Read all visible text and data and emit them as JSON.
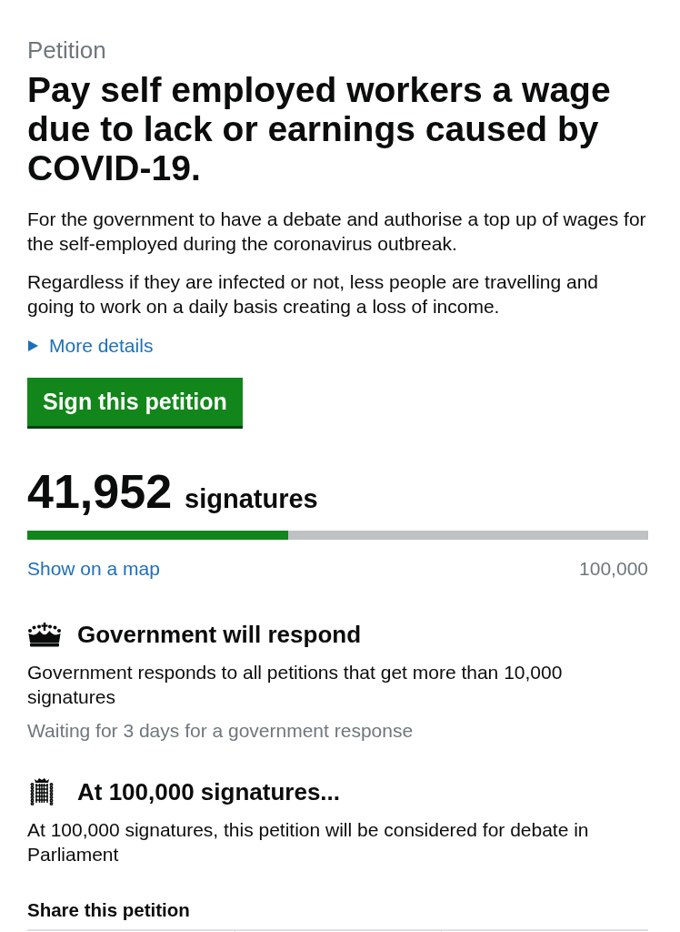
{
  "header": {
    "label": "Petition"
  },
  "title": "Pay self employed workers a wage due to lack or earnings caused by COVID-19.",
  "summary": [
    "For the government to have a debate and authorise a top up of wages for the self-employed during the coronavirus outbreak.",
    "Regardless if they are infected or not, less people are travelling and going to work on a daily basis creating a loss of income."
  ],
  "details_toggle": {
    "label": "More details",
    "expanded": false
  },
  "sign_button": {
    "label": "Sign this petition"
  },
  "signatures": {
    "count": "41,952",
    "label": "signatures",
    "level": 0.41952,
    "map_link": "Show on a map",
    "target": "100,000"
  },
  "thresholds": [
    {
      "kind": "crown",
      "heading": "Government will respond",
      "text": "Government responds to all petitions that get more than 10,000 signatures",
      "status": "Waiting for 3 days for a government response"
    },
    {
      "kind": "portcullis",
      "heading": "At 100,000 signatures...",
      "text": "At 100,000 signatures, this petition will be considered for debate in Parliament"
    }
  ],
  "share": {
    "heading": "Share this petition"
  }
}
